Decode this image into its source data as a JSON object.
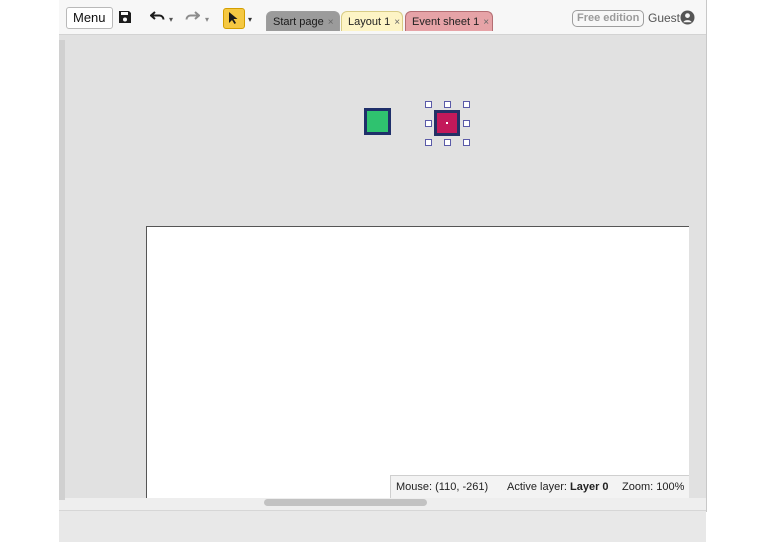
{
  "toolbar": {
    "menu_label": "Menu",
    "save_icon": "save-icon",
    "undo_icon": "undo-icon",
    "redo_icon": "redo-icon",
    "select_tool_icon": "pointer-select-icon",
    "dropdown_glyph": "▾"
  },
  "tabs": [
    {
      "label": "Start page",
      "close": "×"
    },
    {
      "label": "Layout 1",
      "close": "×"
    },
    {
      "label": "Event sheet 1",
      "close": "×"
    }
  ],
  "account": {
    "edition_label": "Free edition",
    "user_label": "Guest",
    "user_icon": "user-circle-icon"
  },
  "status": {
    "mouse_label": "Mouse: (110, -261)",
    "layer_prefix": "Active layer:",
    "layer_name": "Layer 0",
    "zoom_label": "Zoom: 100%"
  },
  "colors": {
    "accent_select_tool": "#f5c842",
    "sprite_green": "#2fc26f",
    "sprite_red": "#c3195a",
    "sprite_border": "#1f2f6a",
    "tab_layout": "#fdf4c5",
    "tab_events": "#e6a3a7",
    "tab_start": "#9b9b9b"
  }
}
